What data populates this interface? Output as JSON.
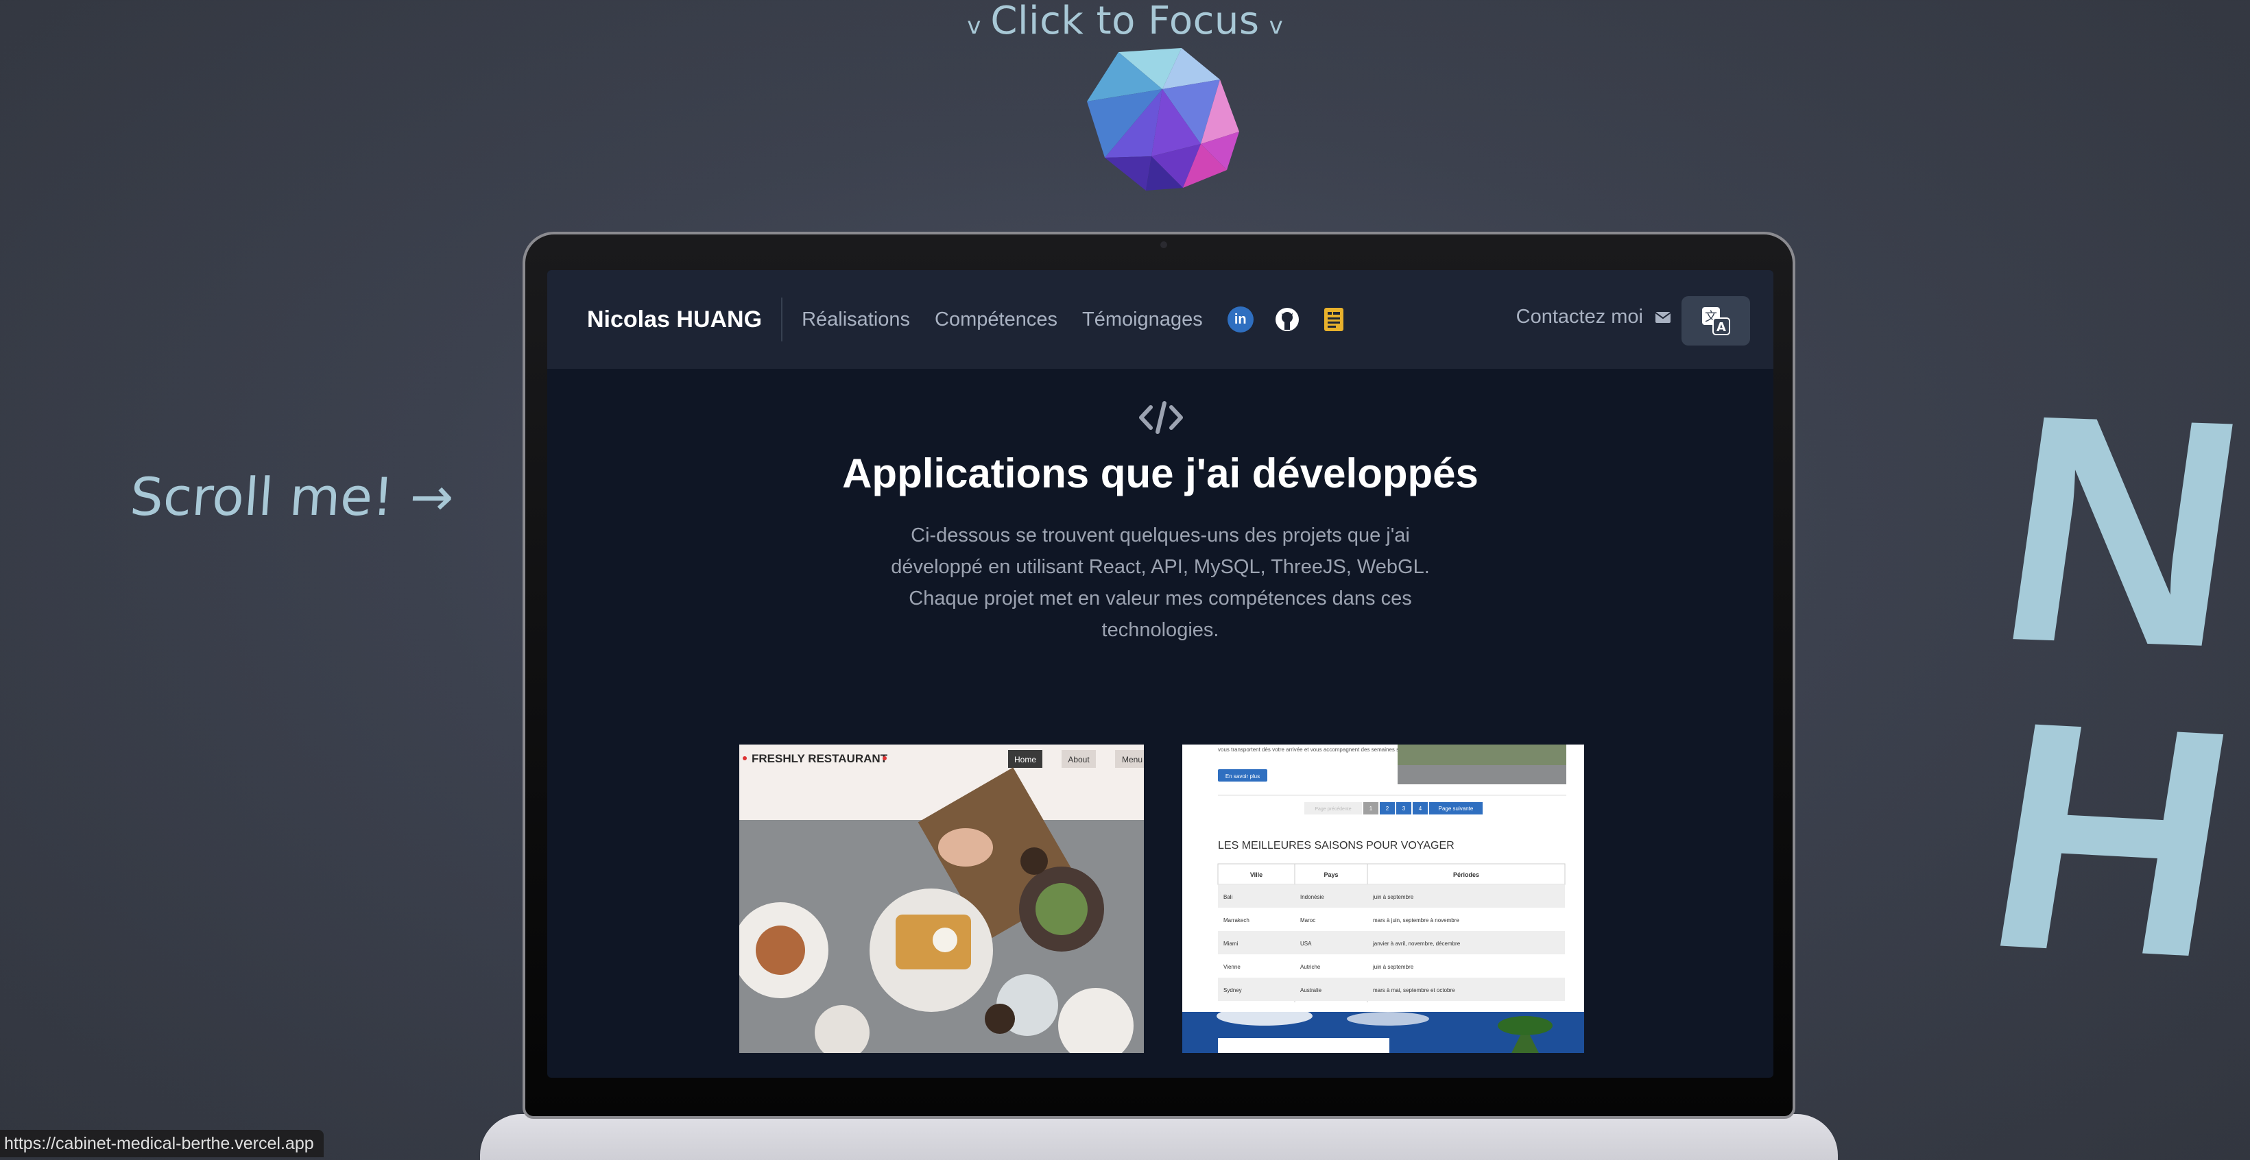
{
  "focus_hint": {
    "left_chevron": "v",
    "label": "Click to Focus",
    "right_chevron": "v"
  },
  "scroll_hint": "Scroll me! →",
  "side_letters": {
    "line1": "N",
    "line2": "H"
  },
  "site": {
    "brand": "Nicolas HUANG",
    "nav": [
      "Réalisations",
      "Compétences",
      "Témoignages"
    ],
    "social_icons": [
      "linkedin-icon",
      "github-icon",
      "resume-icon"
    ],
    "contact_label": "Contactez moi",
    "contact_icon": "mail-icon",
    "lang_icon": "translate-icon",
    "section_icon": "code-icon",
    "headline": "Applications que j'ai développés",
    "intro": "Ci-dessous se trouvent quelques-uns des projets que j'ai développé en utilisant React, API, MySQL, ThreeJS, WebGL. Chaque projet met en valeur mes compétences dans ces technologies."
  },
  "project_restaurant": {
    "title": "FRESHLY RESTAURANT",
    "tabs": [
      "Home",
      "About",
      "Menu"
    ]
  },
  "project_travel": {
    "top_text": "vous transportent dès votre arrivée et vous accompagnent des semaines suivie votre retour.",
    "more_button": "En savoir plus",
    "pagination": [
      "Page précédente",
      "1",
      "2",
      "3",
      "4",
      "Page suivante"
    ],
    "section_title": "LES MEILLEURES SAISONS POUR VOYAGER",
    "table_headers": [
      "Ville",
      "Pays",
      "Périodes"
    ],
    "table_rows": [
      [
        "Bali",
        "Indonésie",
        "juin à septembre"
      ],
      [
        "Marrakech",
        "Maroc",
        "mars à juin, septembre à novembre"
      ],
      [
        "Miami",
        "USA",
        "janvier à avril, novembre, décembre"
      ],
      [
        "Vienne",
        "Autriche",
        "juin à septembre"
      ],
      [
        "Sydney",
        "Australie",
        "mars à mai, septembre et octobre"
      ]
    ]
  },
  "status_url": "https://cabinet-medical-berthe.vercel.app",
  "colors": {
    "background": "#3c414e",
    "hint_text": "#a8c8d6",
    "nav_bg": "#1d2434",
    "screen_bg": "#0f1625",
    "accent_blue": "#2f6fc0",
    "resume_yellow": "#e8b12c"
  }
}
